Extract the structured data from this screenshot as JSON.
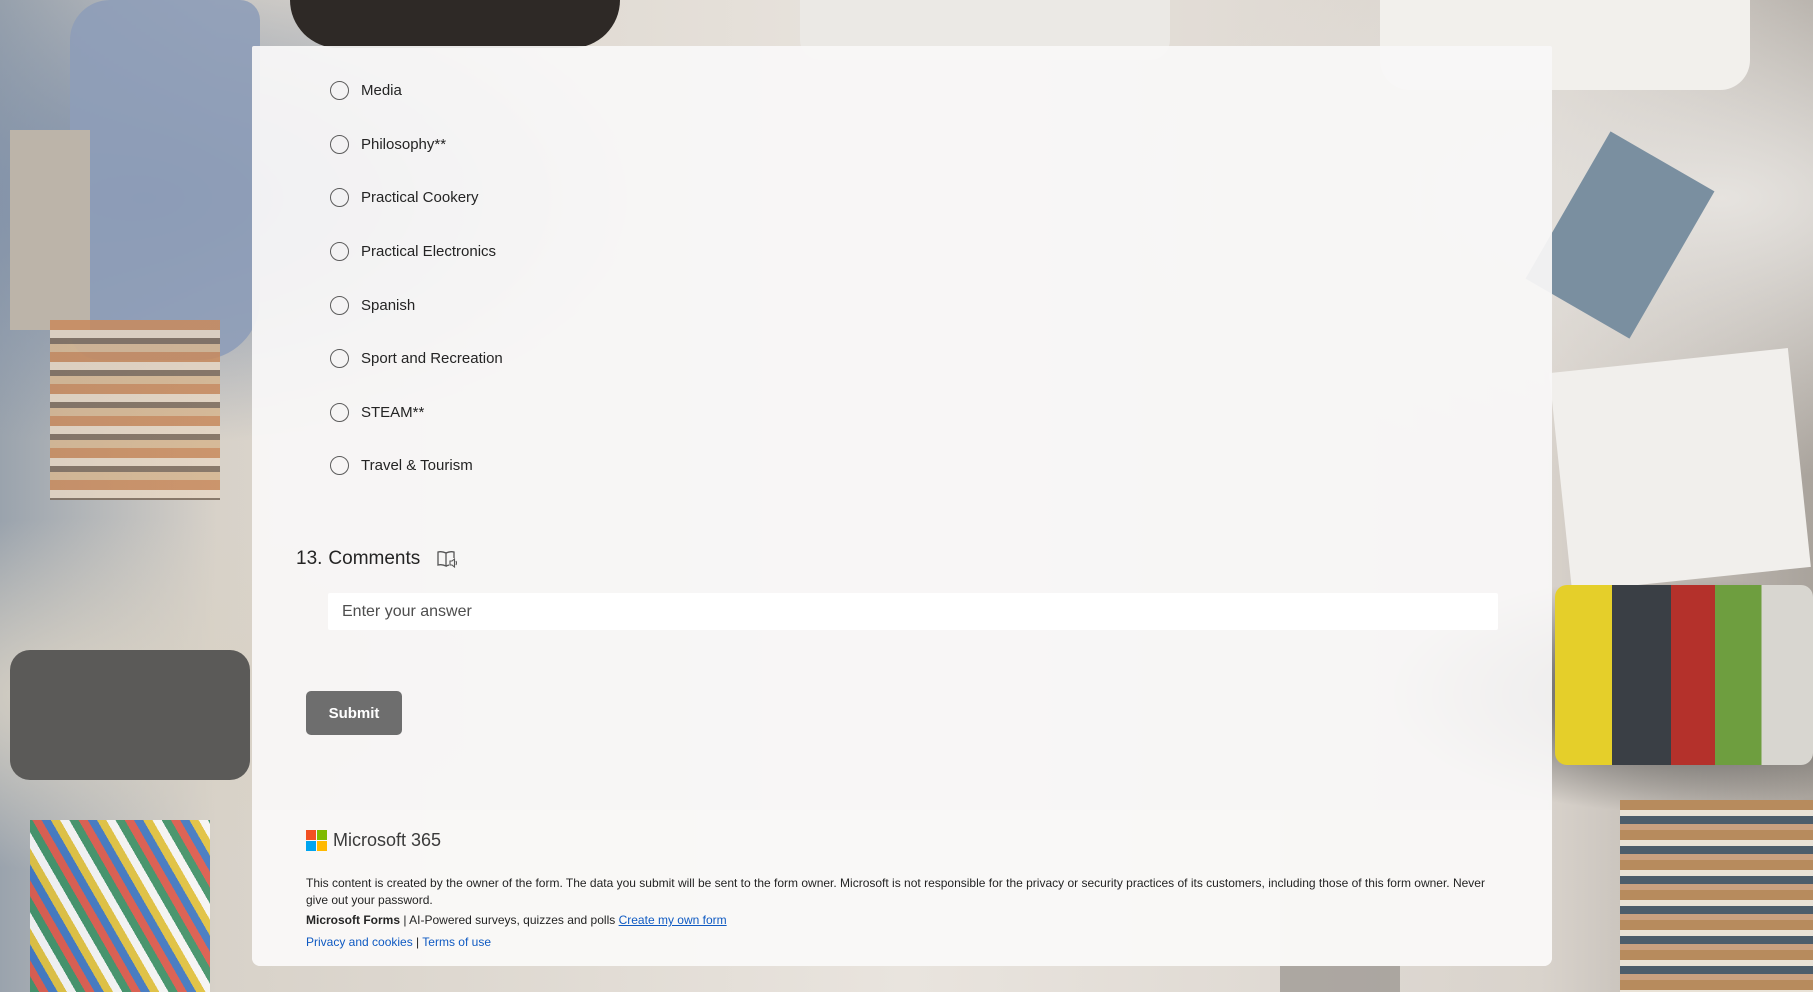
{
  "question12": {
    "options": [
      {
        "label": "Media"
      },
      {
        "label": "Philosophy**"
      },
      {
        "label": "Practical Cookery"
      },
      {
        "label": "Practical Electronics"
      },
      {
        "label": "Spanish"
      },
      {
        "label": "Sport and Recreation"
      },
      {
        "label": "STEAM**"
      },
      {
        "label": "Travel & Tourism"
      }
    ]
  },
  "question13": {
    "number": "13.",
    "title": "Comments",
    "icon": "immersive-reader-icon",
    "placeholder": "Enter your answer"
  },
  "submit_label": "Submit",
  "footer": {
    "brand": "Microsoft 365",
    "logo_colors": [
      "#f25022",
      "#7fba00",
      "#00a4ef",
      "#ffb900"
    ],
    "disclaimer": "This content is created by the owner of the form. The data you submit will be sent to the form owner. Microsoft is not responsible for the privacy or security practices of its customers, including those of this form owner. Never give out your password.",
    "forms_name": "Microsoft Forms",
    "forms_separator": " | ",
    "forms_tagline": "AI-Powered surveys, quizzes and polls",
    "create_link": "Create my own form",
    "privacy_link": "Privacy and cookies",
    "legal_separator": " | ",
    "terms_link": "Terms of use"
  },
  "colors": {
    "submit_bg": "#6e6e6e",
    "link": "#0f5ac2",
    "text": "#242424"
  }
}
